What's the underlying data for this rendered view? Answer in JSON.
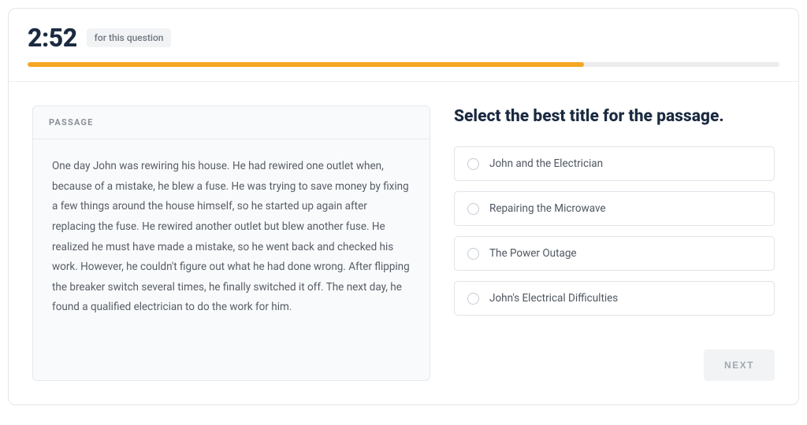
{
  "timer": {
    "value": "2:52",
    "note": "for this question"
  },
  "progress": {
    "percent": 74
  },
  "passage": {
    "header": "PASSAGE",
    "text": "One day John was rewiring his house. He had rewired one outlet when, because of a mistake, he blew a fuse. He was trying to save money by fixing a few things around the house himself, so he started up again after replacing the fuse. He rewired another outlet but blew another fuse. He realized he must have made a mistake, so he went back and checked his work. However, he couldn't figure out what he had done wrong. After flipping the breaker switch several times, he finally switched it off. The next day, he found a qualified electrician to do the work for him."
  },
  "question": {
    "prompt": "Select the best title for the passage.",
    "options": [
      {
        "label": "John and the Electrician"
      },
      {
        "label": "Repairing the Microwave"
      },
      {
        "label": "The Power Outage"
      },
      {
        "label": "John's Electrical Difficulties"
      }
    ]
  },
  "buttons": {
    "next": "NEXT"
  }
}
